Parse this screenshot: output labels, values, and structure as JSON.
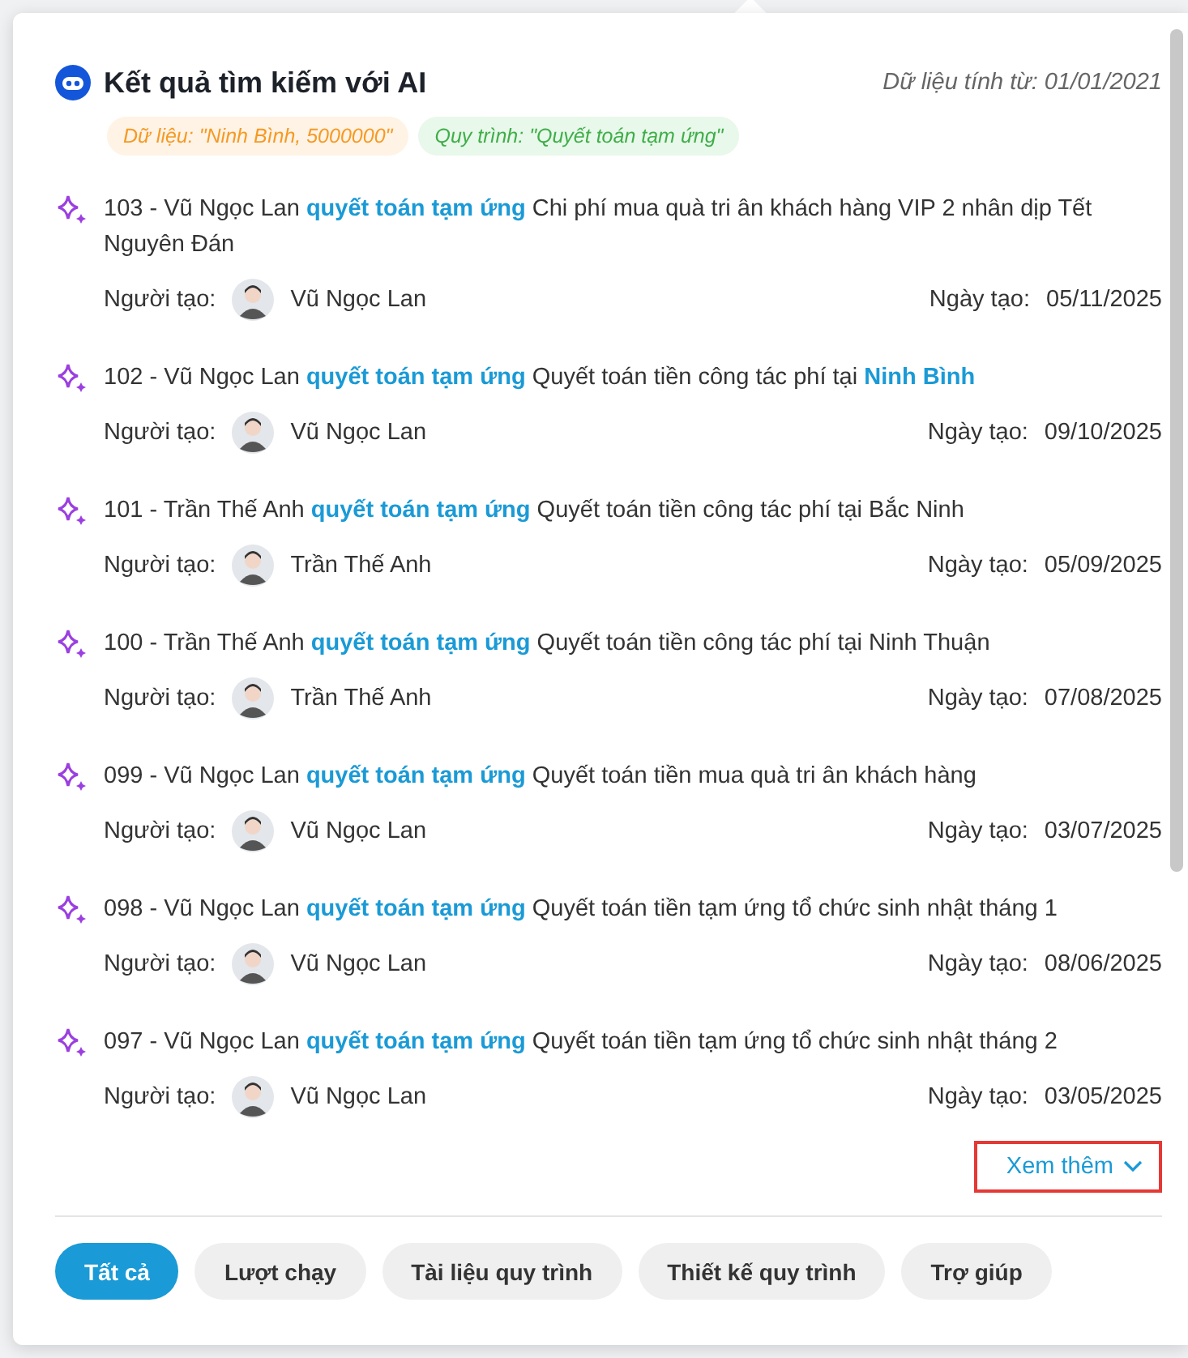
{
  "header": {
    "title": "Kết quả tìm kiếm với AI",
    "date_note": "Dữ liệu tính từ: 01/01/2021"
  },
  "filters": [
    {
      "kind": "data",
      "label": "Dữ liệu: \"Ninh Bình, 5000000\""
    },
    {
      "kind": "process",
      "label": "Quy trình: \"Quyết toán tạm ứng\""
    }
  ],
  "results": [
    {
      "title": "103 - Vũ Ngọc Lan **quyết toán tạm ứng** Chi phí mua quà tri ân khách hàng VIP 2 nhân dịp Tết Nguyên Đán",
      "creator_label": "Người tạo:",
      "creator": "Vũ Ngọc Lan",
      "date_label": "Ngày tạo:",
      "date": "05/11/2025"
    },
    {
      "title": "102 - Vũ Ngọc Lan **quyết toán tạm ứng** Quyết toán tiền công tác phí tại **Ninh Bình**",
      "creator_label": "Người tạo:",
      "creator": "Vũ Ngọc Lan",
      "date_label": "Ngày tạo:",
      "date": "09/10/2025"
    },
    {
      "title": "101 - Trần Thế Anh **quyết toán tạm ứng** Quyết toán tiền công tác phí tại Bắc Ninh",
      "creator_label": "Người tạo:",
      "creator": "Trần Thế Anh",
      "date_label": "Ngày tạo:",
      "date": "05/09/2025"
    },
    {
      "title": "100 - Trần Thế Anh **quyết toán tạm ứng** Quyết toán tiền công tác phí tại Ninh Thuận",
      "creator_label": "Người tạo:",
      "creator": "Trần Thế Anh",
      "date_label": "Ngày tạo:",
      "date": "07/08/2025"
    },
    {
      "title": "099 - Vũ Ngọc Lan **quyết toán tạm ứng** Quyết toán tiền mua quà tri ân khách hàng",
      "creator_label": "Người tạo:",
      "creator": "Vũ Ngọc Lan",
      "date_label": "Ngày tạo:",
      "date": "03/07/2025"
    },
    {
      "title": "098 - Vũ Ngọc Lan **quyết toán tạm ứng** Quyết toán tiền tạm ứng tổ chức sinh nhật tháng 1",
      "creator_label": "Người tạo:",
      "creator": "Vũ Ngọc Lan",
      "date_label": "Ngày tạo:",
      "date": "08/06/2025"
    },
    {
      "title": "097 - Vũ Ngọc Lan **quyết toán tạm ứng** Quyết toán tiền tạm ứng tổ chức sinh nhật tháng 2",
      "creator_label": "Người tạo:",
      "creator": "Vũ Ngọc Lan",
      "date_label": "Ngày tạo:",
      "date": "03/05/2025"
    }
  ],
  "more_link": "Xem thêm",
  "tabs": [
    {
      "label": "Tất cả",
      "selected": true
    },
    {
      "label": "Lượt chạy",
      "selected": false
    },
    {
      "label": "Tài liệu quy trình",
      "selected": false
    },
    {
      "label": "Thiết kế quy trình",
      "selected": false
    },
    {
      "label": "Trợ giúp",
      "selected": false
    }
  ]
}
